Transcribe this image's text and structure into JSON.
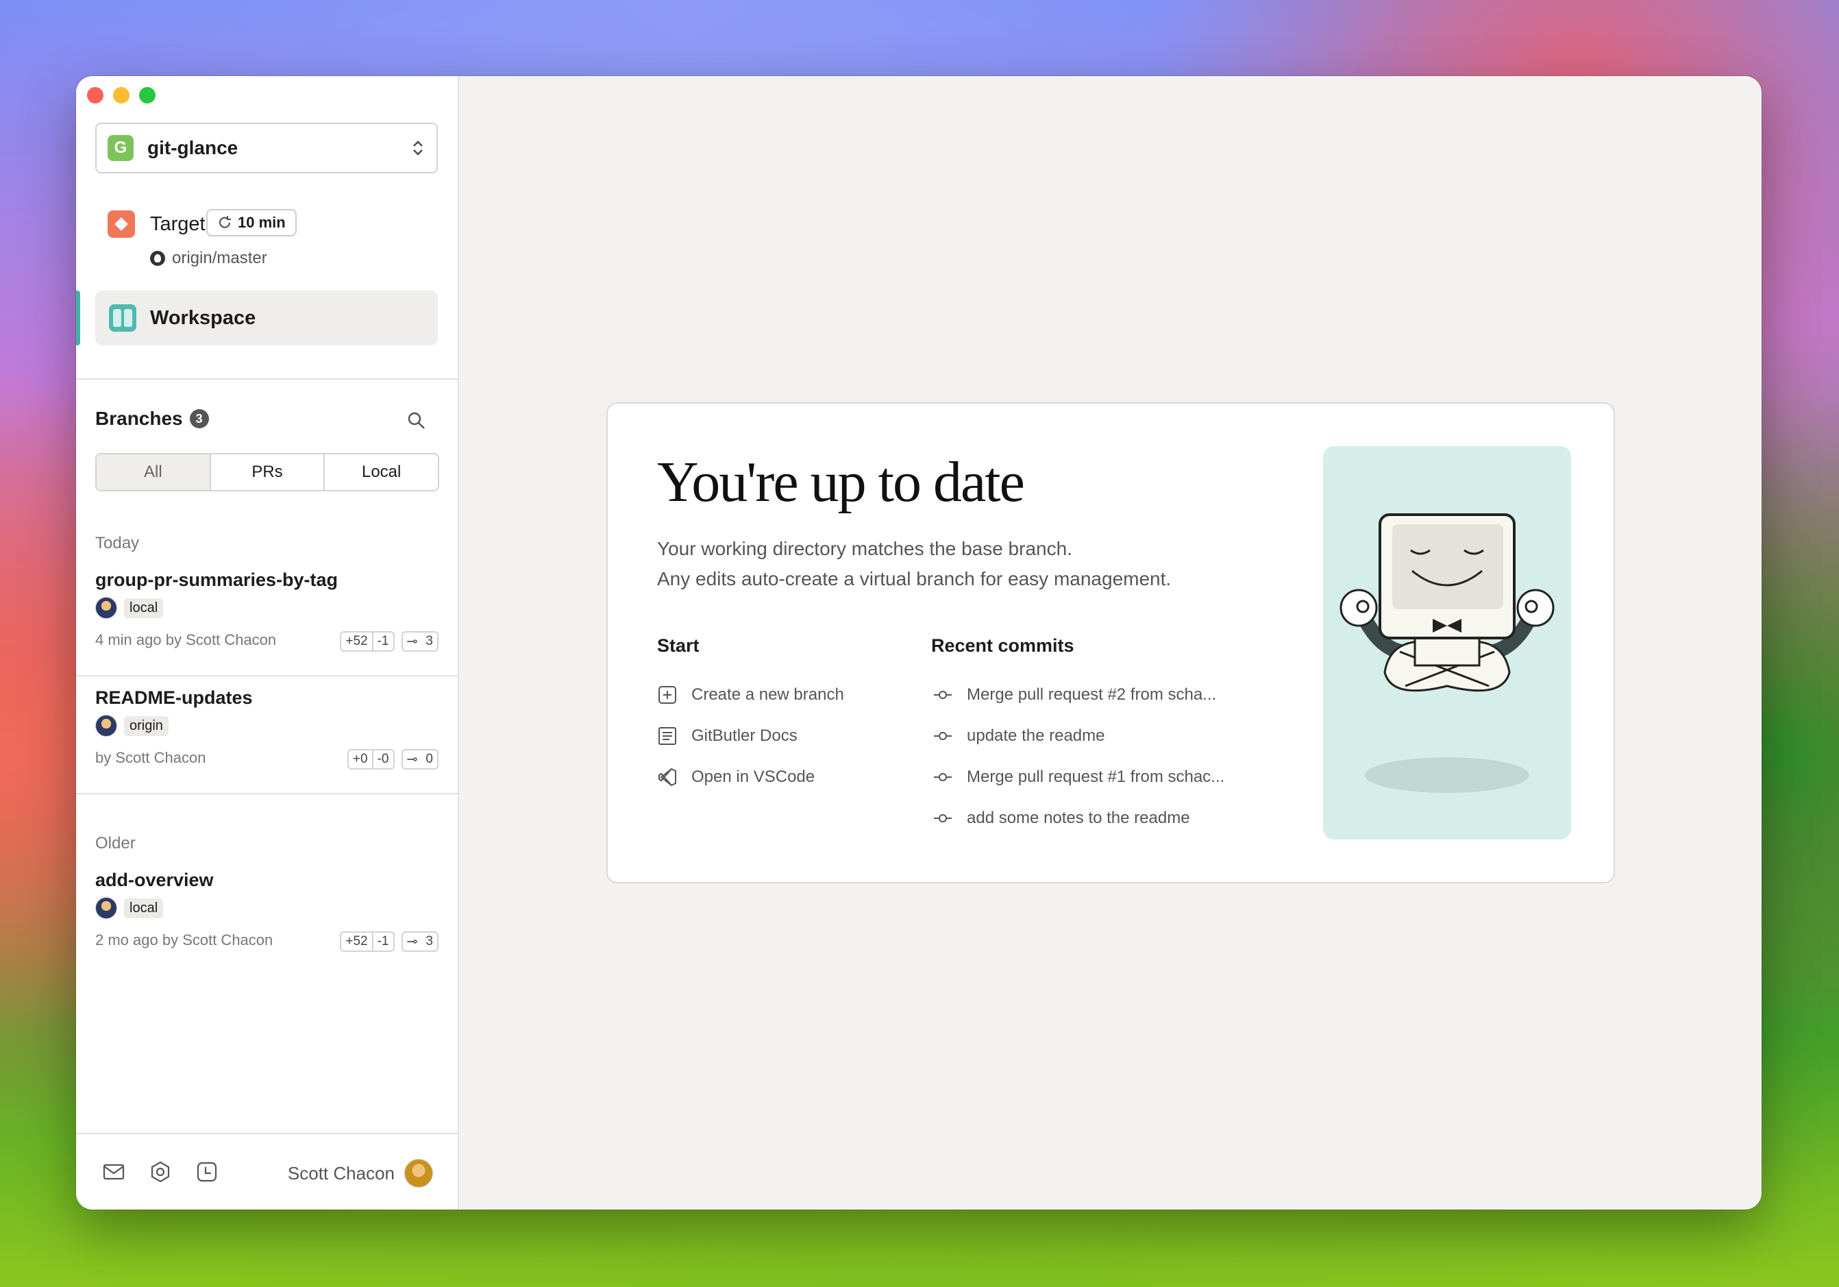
{
  "project": {
    "name": "git-glance",
    "logo_letter": "G"
  },
  "target": {
    "label": "Target",
    "sync": "10 min",
    "branch": "origin/master"
  },
  "workspace": {
    "label": "Workspace"
  },
  "branches": {
    "title": "Branches",
    "count": "3",
    "filters": [
      "All",
      "PRs",
      "Local"
    ],
    "groups": [
      {
        "label": "Today",
        "items": [
          {
            "name": "group-pr-summaries-by-tag",
            "tag": "local",
            "meta": "4 min ago by Scott Chacon",
            "additions": "+52",
            "deletions": "-1",
            "commits": "3"
          },
          {
            "name": "README-updates",
            "tag": "origin",
            "meta": "by Scott Chacon",
            "additions": "+0",
            "deletions": "-0",
            "commits": "0"
          }
        ]
      },
      {
        "label": "Older",
        "items": [
          {
            "name": "add-overview",
            "tag": "local",
            "meta": "2 mo ago by Scott Chacon",
            "additions": "+52",
            "deletions": "-1",
            "commits": "3"
          }
        ]
      }
    ]
  },
  "footer": {
    "user_name": "Scott Chacon"
  },
  "main": {
    "title": "You're up to date",
    "subtitle_line1": "Your working directory matches the base branch.",
    "subtitle_line2": "Any edits auto-create a virtual branch for easy management.",
    "start_title": "Start",
    "start_links": [
      "Create a new branch",
      "GitButler Docs",
      "Open in VSCode"
    ],
    "recent_title": "Recent commits",
    "commits": [
      "Merge pull request #2 from scha...",
      "update the readme",
      "Merge pull request #1 from schac...",
      "add some notes to the readme"
    ]
  },
  "colors": {
    "accent": "#3fb3a8",
    "target": "#f07858",
    "project_logo": "#7cc45a",
    "illustration_bg": "#d6eeea"
  }
}
